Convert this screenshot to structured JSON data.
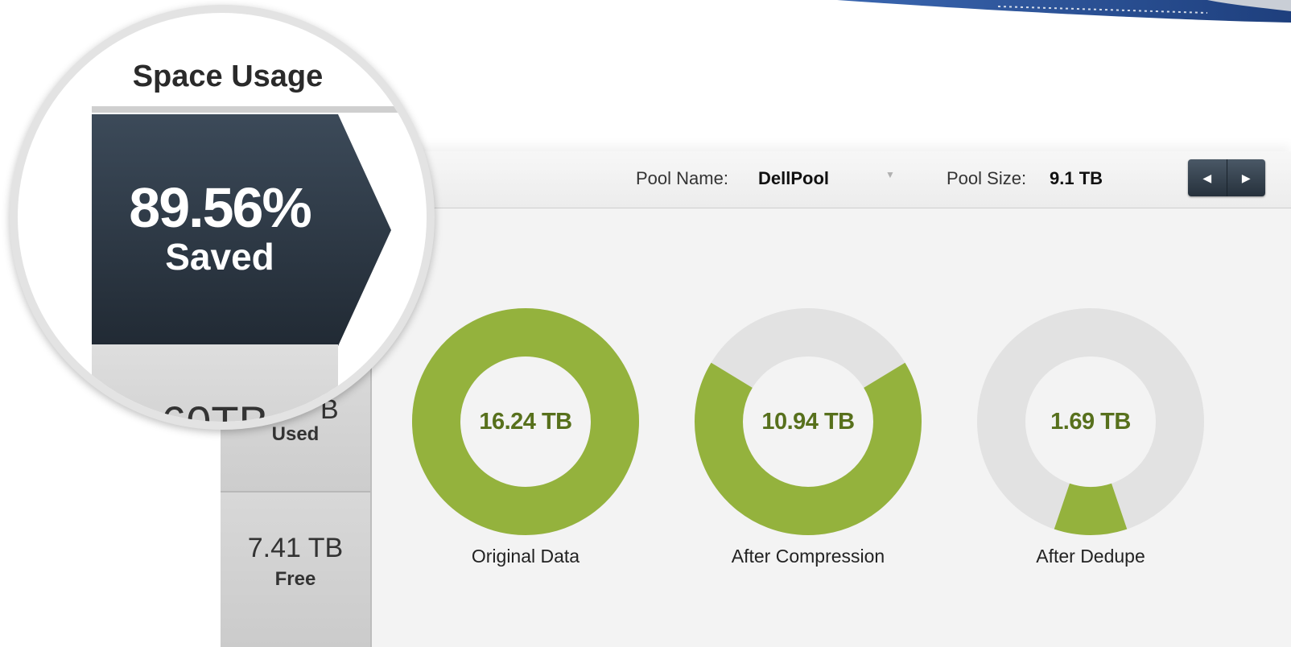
{
  "magnifier": {
    "title": "Space Usage",
    "percent": "89.56%",
    "saved_label": "Saved",
    "used_value_fragment": "60TB"
  },
  "header": {
    "pool_name_label": "Pool Name:",
    "pool_name_value": "DellPool",
    "pool_size_label": "Pool Size:",
    "pool_size_value": "9.1 TB",
    "nav_prev_icon": "◀",
    "nav_next_icon": "▶"
  },
  "stats": {
    "used_fragment": "B",
    "used_label": "Used",
    "free_value": "7.41 TB",
    "free_label": "Free"
  },
  "donuts": [
    {
      "value": "16.24 TB",
      "caption": "Original Data",
      "fraction": 1.0
    },
    {
      "value": "10.94 TB",
      "caption": "After Compression",
      "fraction": 0.674
    },
    {
      "value": "1.69 TB",
      "caption": "After Dedupe",
      "fraction": 0.104
    }
  ],
  "colors": {
    "green": "#94b23d",
    "green_dark": "#6f8b2a",
    "track": "#e2e2e2",
    "text_green": "#57701c",
    "dark_navy": "#2c3845"
  }
}
